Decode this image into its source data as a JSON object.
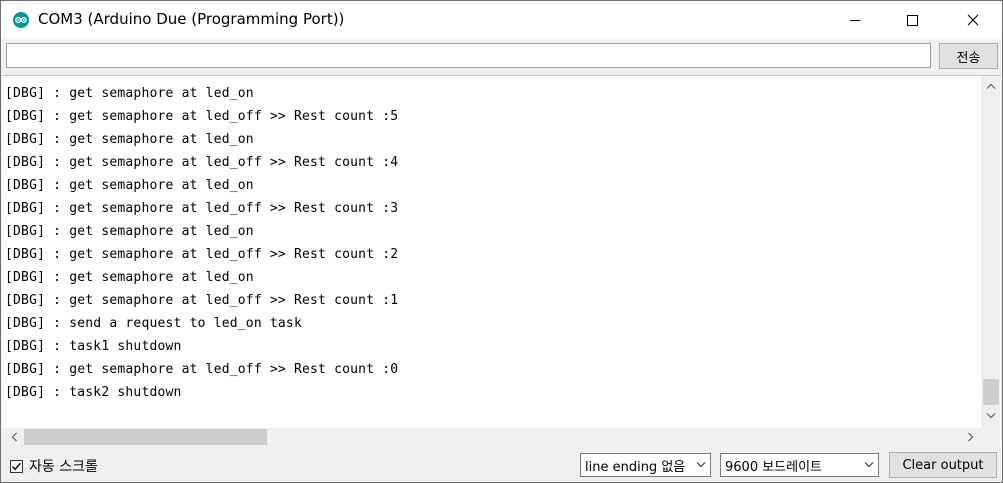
{
  "window": {
    "title": "COM3 (Arduino Due (Programming Port))",
    "app_icon": "arduino-logo-icon",
    "controls": [
      "minimize-icon",
      "maximize-icon",
      "close-icon"
    ]
  },
  "send": {
    "input_value": "",
    "button_label": "전송"
  },
  "output": {
    "lines": [
      "[DBG] : get semaphore at led_on",
      "[DBG] : get semaphore at led_off >> Rest count :5",
      "[DBG] : get semaphore at led_on",
      "[DBG] : get semaphore at led_off >> Rest count :4",
      "[DBG] : get semaphore at led_on",
      "[DBG] : get semaphore at led_off >> Rest count :3",
      "[DBG] : get semaphore at led_on",
      "[DBG] : get semaphore at led_off >> Rest count :2",
      "[DBG] : get semaphore at led_on",
      "[DBG] : get semaphore at led_off >> Rest count :1",
      "[DBG] : send a request to led_on task",
      "[DBG] : task1 shutdown",
      "[DBG] : get semaphore at led_off >> Rest count :0",
      "[DBG] : task2 shutdown"
    ]
  },
  "footer": {
    "autoscroll_label": "자동 스크롤",
    "autoscroll_checked": true,
    "line_ending": "line ending 없음",
    "baud_rate": "9600 보드레이트",
    "clear_label": "Clear output"
  }
}
